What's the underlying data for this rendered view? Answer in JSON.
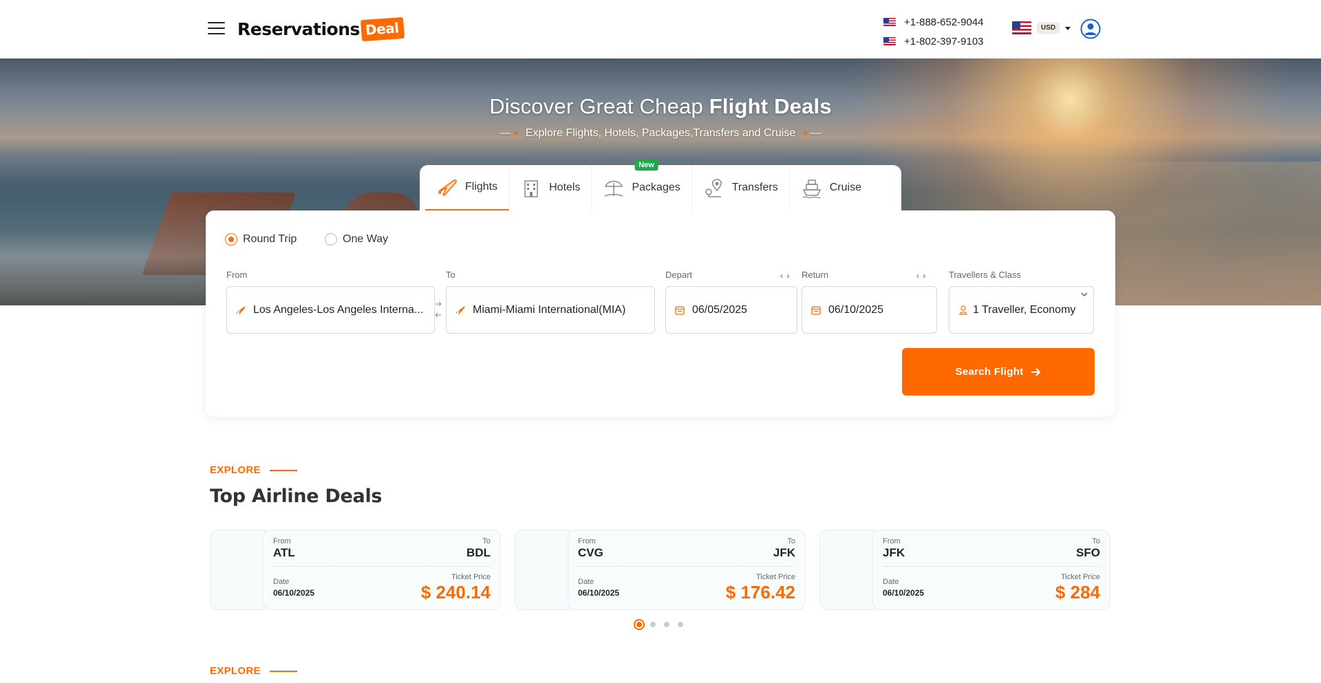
{
  "header": {
    "logo_text": "Reservations",
    "logo_badge": "Deal",
    "phones": [
      "+1-888-652-9044",
      "+1-802-397-9103"
    ],
    "currency": "USD"
  },
  "hero": {
    "title_light": "Discover Great Cheap ",
    "title_bold": "Flight Deals",
    "subtitle": "Explore Flights, Hotels, Packages,Transfers and Cruise"
  },
  "tabs": [
    {
      "label": "Flights",
      "icon": "plane-icon",
      "active": true
    },
    {
      "label": "Hotels",
      "icon": "hotel-icon"
    },
    {
      "label": "Packages",
      "icon": "beach-umbrella-icon",
      "badge": "New"
    },
    {
      "label": "Transfers",
      "icon": "map-pin-icon"
    },
    {
      "label": "Cruise",
      "icon": "ship-icon"
    }
  ],
  "search": {
    "trip_types": [
      "Round Trip",
      "One Way"
    ],
    "selected_trip": "Round Trip",
    "labels": {
      "from": "From",
      "to": "To",
      "depart": "Depart",
      "return": "Return",
      "travellers": "Travellers & Class"
    },
    "from_value": "Los Angeles-Los Angeles Interna...",
    "to_value": "Miami-Miami International(MIA)",
    "depart_value": "06/05/2025",
    "return_value": "06/10/2025",
    "travellers_value": "1 Traveller, Economy",
    "button_label": "Search Flight",
    "accent": "#ff6a00"
  },
  "explore": {
    "eyebrow": "EXPLORE",
    "title": "Top Airline Deals",
    "labels": {
      "from": "From",
      "to": "To",
      "date": "Date",
      "price": "Ticket Price"
    },
    "deals": [
      {
        "from": "ATL",
        "to": "BDL",
        "date": "06/10/2025",
        "price": "$ 240.14"
      },
      {
        "from": "CVG",
        "to": "JFK",
        "date": "06/10/2025",
        "price": "$ 176.42"
      },
      {
        "from": "JFK",
        "to": "SFO",
        "date": "06/10/2025",
        "price": "$ 284"
      }
    ],
    "carousel_pages": 4,
    "carousel_active": 1,
    "eyebrow_2": "EXPLORE"
  }
}
